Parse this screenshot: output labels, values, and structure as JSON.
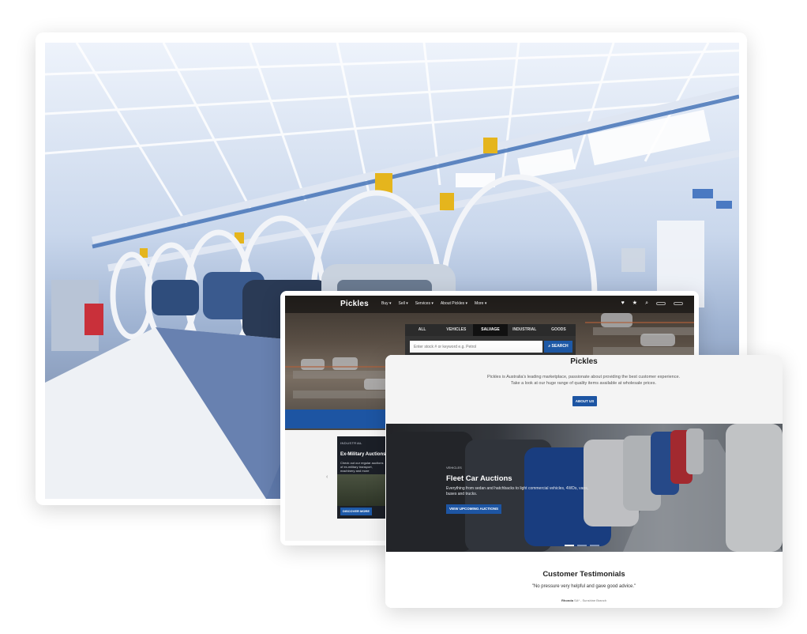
{
  "factory_card": {
    "image_alt": "car-assembly-line-photo"
  },
  "home_page": {
    "logo": "Pickles",
    "nav_items": [
      "Buy ▾",
      "Sell ▾",
      "Services ▾",
      "About Pickles ▾",
      "More ▾"
    ],
    "nav_buttons": [
      "",
      ""
    ],
    "search_tabs": [
      "ALL",
      "VEHICLES",
      "SALVAGE",
      "INDUSTRIAL",
      "GOODS"
    ],
    "active_tab": "SALVAGE",
    "search_placeholder": "Enter stock # or keyword e.g. Petrol",
    "search_button": "SEARCH",
    "promo": {
      "tag": "INDUSTRIAL",
      "title": "Ex-Military Auctions",
      "description": "Check out our regular auctions of ex-military transport, machinery and more",
      "button": "DISCOVER MORE"
    }
  },
  "about_page": {
    "title": "Pickles",
    "description": "Pickles is Australia's leading marketplace, passionate about providing the best customer experience. Take a look at our huge range of quality items available at wholesale prices.",
    "about_button": "ABOUT US",
    "fleet": {
      "tag": "VEHICLES",
      "title": "Fleet Car Auctions",
      "description": "Everything from sedan and hatchbacks to light commercial vehicles, 4WDs, vans, buses and trucks.",
      "button": "VIEW UPCOMING AUCTIONS"
    },
    "testimonials": {
      "title": "Customer Testimonials",
      "quote": "\"No pressure very helpful and gave good advice.\"",
      "author_name": "Rhonda",
      "author_detail": "SA* - Sunshine Branch"
    }
  }
}
